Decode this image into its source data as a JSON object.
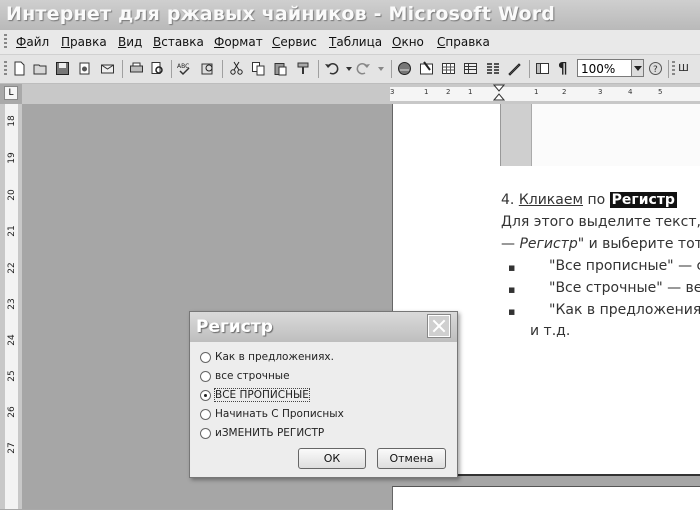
{
  "window": {
    "title": "Интернет для ржавых чайников - Microsoft Word"
  },
  "menu": [
    "Файл",
    "Правка",
    "Вид",
    "Вставка",
    "Формат",
    "Сервис",
    "Таблица",
    "Окно",
    "Справка"
  ],
  "toolbar": {
    "zoom": "100%",
    "more_icon": "ш"
  },
  "ruler": {
    "tab_selector": "L",
    "h_ticks": [
      "3",
      "1",
      "2",
      "1",
      "1",
      "2",
      "3",
      "4",
      "5"
    ],
    "v_ticks": [
      "18",
      "19",
      "20",
      "21",
      "22",
      "23",
      "24",
      "25",
      "26",
      "27"
    ]
  },
  "document": {
    "heading_num": "4.",
    "heading_link": "Кликаем",
    "heading_mid": "по",
    "heading_highlight": "Регистр",
    "line1": "Для этого выделите текст, к",
    "line2_dash": "—",
    "line2_italic": "Регистр\"",
    "line2_rest": "и выберите тот в",
    "bullet_char": "▪",
    "bullets": [
      "\"Все прописные\" — сд",
      "\"Все строчные\" — вес",
      "\"Как в предложениях"
    ],
    "etc": "и т.д."
  },
  "dialog": {
    "title": "Регистр",
    "options": [
      {
        "label": "Как в предложениях.",
        "selected": false
      },
      {
        "label": "все строчные",
        "selected": false
      },
      {
        "label": "ВСЕ ПРОПИСНЫЕ",
        "selected": true
      },
      {
        "label": "Начинать С Прописных",
        "selected": false
      },
      {
        "label": "иЗМЕНИТЬ РЕГИСТР",
        "selected": false
      }
    ],
    "ok": "ОК",
    "cancel": "Отмена"
  },
  "icons": [
    "new-document-icon",
    "open-icon",
    "save-icon",
    "permission-icon",
    "email-icon",
    "print-icon",
    "print-preview-icon",
    "spelling-icon",
    "research-icon",
    "cut-icon",
    "copy-icon",
    "paste-icon",
    "format-painter-icon",
    "undo-icon",
    "redo-icon",
    "hyperlink-icon",
    "tables-borders-icon",
    "insert-table-icon",
    "insert-excel-icon",
    "columns-icon",
    "drawing-icon",
    "document-map-icon",
    "show-formatting-icon",
    "help-icon",
    "read-icon"
  ],
  "colors": {
    "highlight_bg": "#111111",
    "dialog_bg": "#ececec",
    "desktop_gray": "#a6a6a6"
  }
}
